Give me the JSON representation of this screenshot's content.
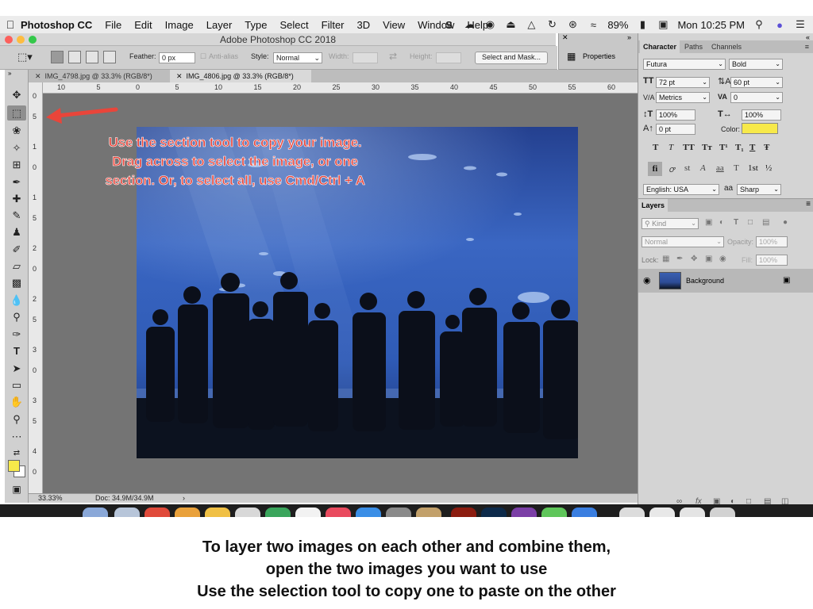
{
  "menubar": {
    "app": "Photoshop CC",
    "items": [
      "File",
      "Edit",
      "Image",
      "Layer",
      "Type",
      "Select",
      "Filter",
      "3D",
      "View",
      "Window",
      "Help"
    ],
    "battery": "89%",
    "clock": "Mon 10:25 PM",
    "status_icons": [
      "s-icon",
      "cloud-icon",
      "cc-icon",
      "eject-icon",
      "airplay-icon",
      "time-machine-icon",
      "bluetooth-icon",
      "wifi-icon",
      "battery-icon",
      "display-icon",
      "search-icon",
      "siri-icon",
      "list-icon"
    ]
  },
  "window": {
    "title": "Adobe Photoshop CC 2018"
  },
  "options": {
    "feather_label": "Feather:",
    "feather_value": "0 px",
    "antialias_label": "Anti-alias",
    "style_label": "Style:",
    "style_value": "Normal",
    "width_label": "Width:",
    "height_label": "Height:",
    "select_mask_label": "Select and Mask..."
  },
  "properties": {
    "label": "Properties"
  },
  "doc_tabs": [
    {
      "label": "IMG_4798.jpg @ 33.3% (RGB/8*)"
    },
    {
      "label": "IMG_4806.jpg @ 33.3% (RGB/8*)"
    }
  ],
  "ruler_top": [
    "10",
    "5",
    "0",
    "5",
    "10",
    "15",
    "20",
    "25",
    "30",
    "35",
    "40",
    "45",
    "50",
    "55",
    "60"
  ],
  "ruler_left": [
    "0",
    "5",
    "1",
    "0",
    "1",
    "5",
    "2",
    "0",
    "2",
    "5",
    "3",
    "0",
    "3",
    "5",
    "4",
    "0"
  ],
  "annotation": {
    "line1": "Use the section tool to copy your image.",
    "line2": "Drag across to select the image, or one",
    "line3": "section. Or, to select all, use Cmd/Ctrl + A"
  },
  "status": {
    "zoom": "33.33%",
    "doc": "Doc: 34.9M/34.9M"
  },
  "character": {
    "tabs": [
      "Character",
      "Paths",
      "Channels"
    ],
    "font": "Futura",
    "weight": "Bold",
    "size": "72 pt",
    "leading": "60 pt",
    "kerning": "Metrics",
    "tracking": "0",
    "vscale": "100%",
    "hscale": "100%",
    "baseline": "0 pt",
    "color_label": "Color:",
    "color": "#f7e94a",
    "style_buttons": [
      "T",
      "T",
      "TT",
      "Tт",
      "T¹",
      "T₁",
      "T",
      "Ŧ"
    ],
    "opentype_buttons": [
      "fi",
      "ꝍ",
      "st",
      "A",
      "aa",
      "T",
      "1st",
      "½"
    ],
    "language": "English: USA",
    "aa_label": "aa",
    "antialias": "Sharp"
  },
  "layers": {
    "title": "Layers",
    "kind": "Kind",
    "blend": "Normal",
    "opacity_label": "Opacity:",
    "opacity": "100%",
    "lock_label": "Lock:",
    "fill_label": "Fill:",
    "fill": "100%",
    "items": [
      {
        "name": "Background"
      }
    ]
  },
  "caption": {
    "line1": "To layer two images on each other and combine them,",
    "line2": "open the two images you want to use",
    "line3": "Use the selection tool to copy one to paste on the other"
  },
  "colors": {
    "annotation_text": "#e9453a",
    "arrow": "#e9453a",
    "foreground": "#f7e94a",
    "background": "#ffffff"
  }
}
